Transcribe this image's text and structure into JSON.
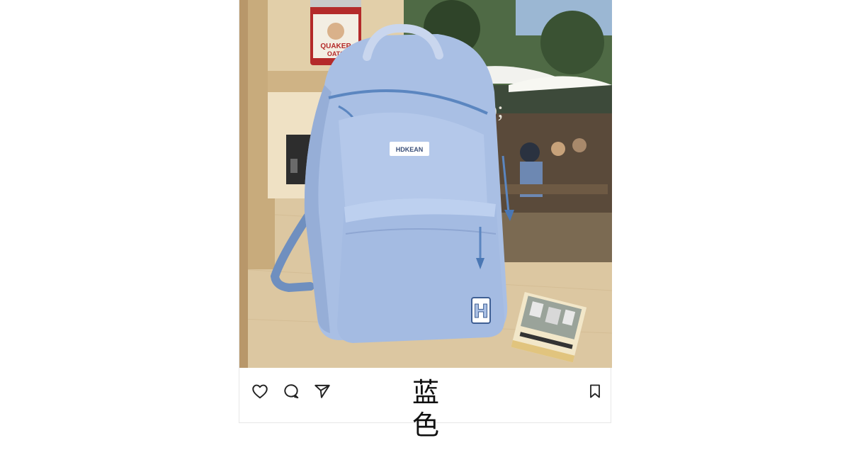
{
  "post": {
    "image_alt": "Light blue school backpack with HDKEAN patch and H emblem",
    "product_patch_text": "HDKEAN",
    "emblem_letter": "H",
    "can_label": "QUAKER OATS",
    "caption": "蓝 色"
  },
  "actions": {
    "like_icon": "heart-icon",
    "comment_icon": "comment-icon",
    "share_icon": "send-icon",
    "save_icon": "bookmark-icon"
  },
  "colors": {
    "backpack": "#a9bfe4",
    "backpack_shadow": "#8ea6d2",
    "zipper": "#5b86c0",
    "shelf_wood": "#d9c39c",
    "icon_stroke": "#222222"
  }
}
